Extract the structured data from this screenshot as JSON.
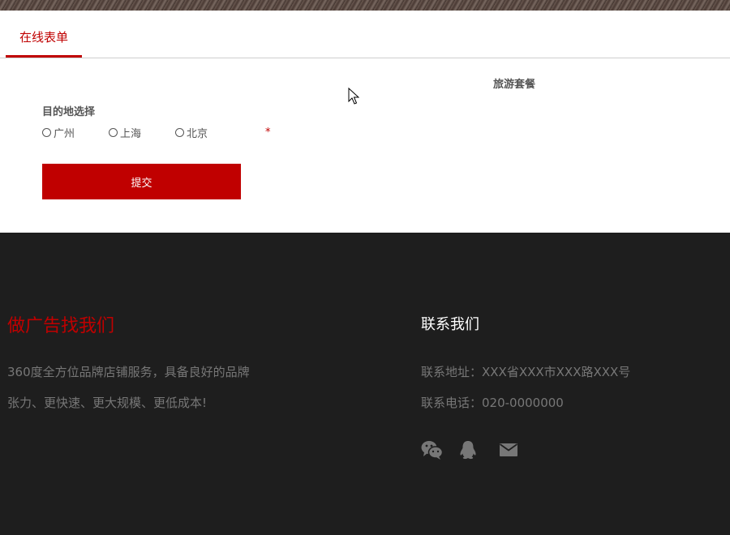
{
  "tabs": {
    "active_label": "在线表单"
  },
  "form": {
    "package_title": "旅游套餐",
    "destination_label": "目的地选择",
    "options": [
      "广州",
      "上海",
      "北京"
    ],
    "required_mark": "*",
    "submit_label": "提交"
  },
  "footer": {
    "ad_title": "做广告找我们",
    "ad_lines": [
      "360度全方位品牌店铺服务，具备良好的品牌",
      "张力、更快速、更大规模、更低成本!"
    ],
    "contact_title": "联系我们",
    "contact_address": "联系地址：XXX省XXX市XXX路XXX号",
    "contact_phone": "联系电话：020-0000000",
    "social_icons": [
      "wechat-icon",
      "qq-icon",
      "mail-icon"
    ]
  },
  "colors": {
    "accent": "#c00000",
    "footer_bg": "#1e1e1e",
    "muted_text": "#777777"
  }
}
